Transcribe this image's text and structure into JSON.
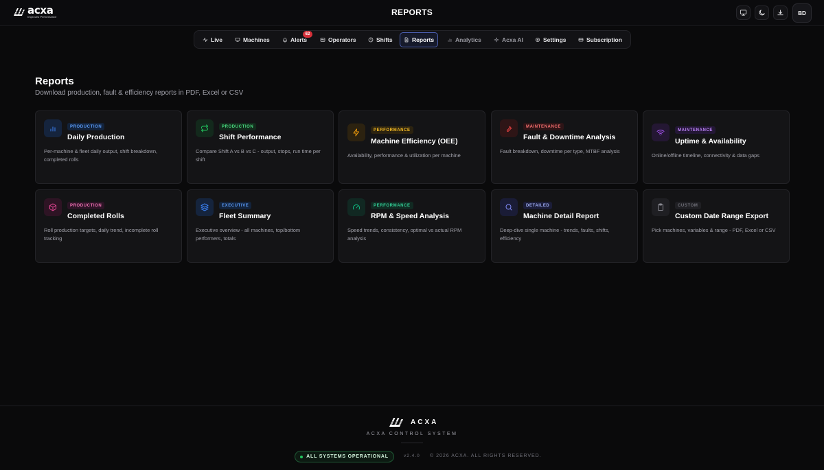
{
  "header": {
    "logo_word": "acxa",
    "logo_tagline": "Improves Performance",
    "title": "REPORTS",
    "avatar_initials": "BD"
  },
  "nav": {
    "items": [
      {
        "label": "Live",
        "icon": "activity-icon"
      },
      {
        "label": "Machines",
        "icon": "monitor-icon"
      },
      {
        "label": "Alerts",
        "icon": "bell-icon"
      },
      {
        "label": "Operators",
        "icon": "id-card-icon"
      },
      {
        "label": "Shifts",
        "icon": "clock-icon"
      },
      {
        "label": "Reports",
        "icon": "file-icon",
        "active": true
      },
      {
        "label": "Analytics",
        "icon": "bar-chart-icon"
      },
      {
        "label": "Acxa AI",
        "icon": "sparkle-icon"
      },
      {
        "label": "Settings",
        "icon": "gear-icon"
      },
      {
        "label": "Subscription",
        "icon": "credit-card-icon"
      }
    ],
    "alerts_badge": "62"
  },
  "main": {
    "title": "Reports",
    "subtitle": "Download production, fault & efficiency reports in PDF, Excel or CSV"
  },
  "cards": [
    {
      "tag": "PRODUCTION",
      "title": "Daily Production",
      "desc": "Per-machine & fleet daily output, shift breakdown, completed rolls",
      "icon": "bar-chart-icon",
      "color": "#3b82f6"
    },
    {
      "tag": "PRODUCTION",
      "title": "Shift Performance",
      "desc": "Compare Shift A vs B vs C - output, stops, run time per shift",
      "icon": "repeat-icon",
      "color": "#22c55e"
    },
    {
      "tag": "PERFORMANCE",
      "title": "Machine Efficiency (OEE)",
      "desc": "Availability, performance & utilization per machine",
      "icon": "lightning-icon",
      "color": "#f59e0b"
    },
    {
      "tag": "MAINTENANCE",
      "title": "Fault & Downtime Analysis",
      "desc": "Fault breakdown, downtime per type, MTBF analysis",
      "icon": "wrench-icon",
      "color": "#ef4444"
    },
    {
      "tag": "MAINTENANCE",
      "title": "Uptime & Availability",
      "desc": "Online/offline timeline, connectivity & data gaps",
      "icon": "wifi-icon",
      "color": "#a855f7"
    },
    {
      "tag": "PRODUCTION",
      "title": "Completed Rolls",
      "desc": "Roll production targets, daily trend, incomplete roll tracking",
      "icon": "box-icon",
      "color": "#ec4899"
    },
    {
      "tag": "EXECUTIVE",
      "title": "Fleet Summary",
      "desc": "Executive overview - all machines, top/bottom performers, totals",
      "icon": "layers-icon",
      "color": "#3b82f6"
    },
    {
      "tag": "PERFORMANCE",
      "title": "RPM & Speed Analysis",
      "desc": "Speed trends, consistency, optimal vs actual RPM analysis",
      "icon": "gauge-icon",
      "color": "#10b981"
    },
    {
      "tag": "DETAILED",
      "title": "Machine Detail Report",
      "desc": "Deep-dive single machine - trends, faults, shifts, efficiency",
      "icon": "search-icon",
      "color": "#6366f1"
    },
    {
      "tag": "CUSTOM",
      "title": "Custom Date Range Export",
      "desc": "Pick machines, variables & range - PDF, Excel or CSV",
      "icon": "clipboard-icon",
      "color": "#71717a"
    }
  ],
  "footer": {
    "brand": "ACXA",
    "system": "ACXA CONTROL SYSTEM",
    "status": "ALL SYSTEMS OPERATIONAL",
    "version": "v2.4.0",
    "copyright": "© 2026 ACXA. ALL RIGHTS RESERVED."
  }
}
